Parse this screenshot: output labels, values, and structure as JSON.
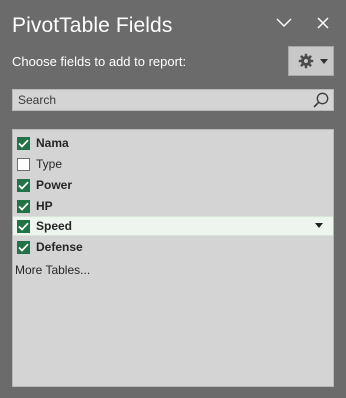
{
  "pane": {
    "title": "PivotTable Fields",
    "subtitle": "Choose fields to add to report:"
  },
  "header": {
    "collapse_icon": "chevron-down-icon",
    "close_icon": "close-icon"
  },
  "settings": {
    "icon": "gear-icon",
    "dropdown_icon": "caret-down-icon"
  },
  "search": {
    "placeholder": "Search",
    "value": "",
    "icon": "search-icon"
  },
  "fields": [
    {
      "label": "Nama",
      "checked": true,
      "selected": false
    },
    {
      "label": "Type",
      "checked": false,
      "selected": false
    },
    {
      "label": "Power",
      "checked": true,
      "selected": false
    },
    {
      "label": "HP",
      "checked": true,
      "selected": false
    },
    {
      "label": "Speed",
      "checked": true,
      "selected": true
    },
    {
      "label": "Defense",
      "checked": true,
      "selected": false
    }
  ],
  "more_tables": "More Tables...",
  "colors": {
    "pane_background": "#6b6b6b",
    "checkbox_checked": "#217346",
    "list_background": "#d4d4d4",
    "selected_row": "#eef5ee"
  }
}
